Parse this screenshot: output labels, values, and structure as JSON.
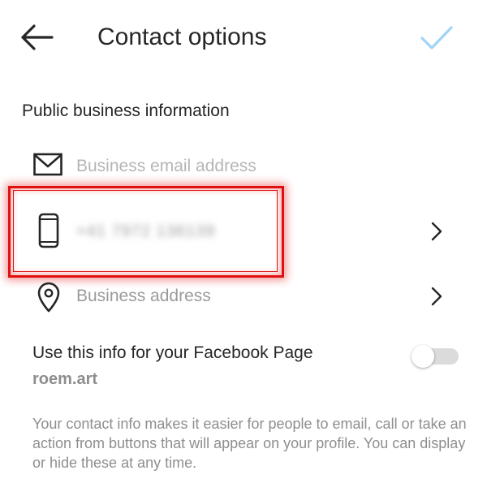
{
  "header": {
    "title": "Contact options",
    "back_icon": "arrow-left-icon",
    "confirm_icon": "check-icon",
    "accent_color": "#9fd4f6"
  },
  "section": {
    "title": "Public business information"
  },
  "fields": {
    "email": {
      "placeholder": "Business email address",
      "icon": "envelope-icon"
    },
    "phone": {
      "value": "+41 7972 136139",
      "icon": "mobile-phone-icon"
    },
    "address": {
      "placeholder": "Business address",
      "icon": "map-pin-icon"
    }
  },
  "facebook": {
    "label": "Use this info for your Facebook Page",
    "page_name": "roem.art",
    "toggle_on": false
  },
  "footer": {
    "note": "Your contact info makes it easier for people to email, call or take an action from buttons that will appear on your profile. You can display or hide these at any time."
  },
  "highlight_color": "#e01010"
}
